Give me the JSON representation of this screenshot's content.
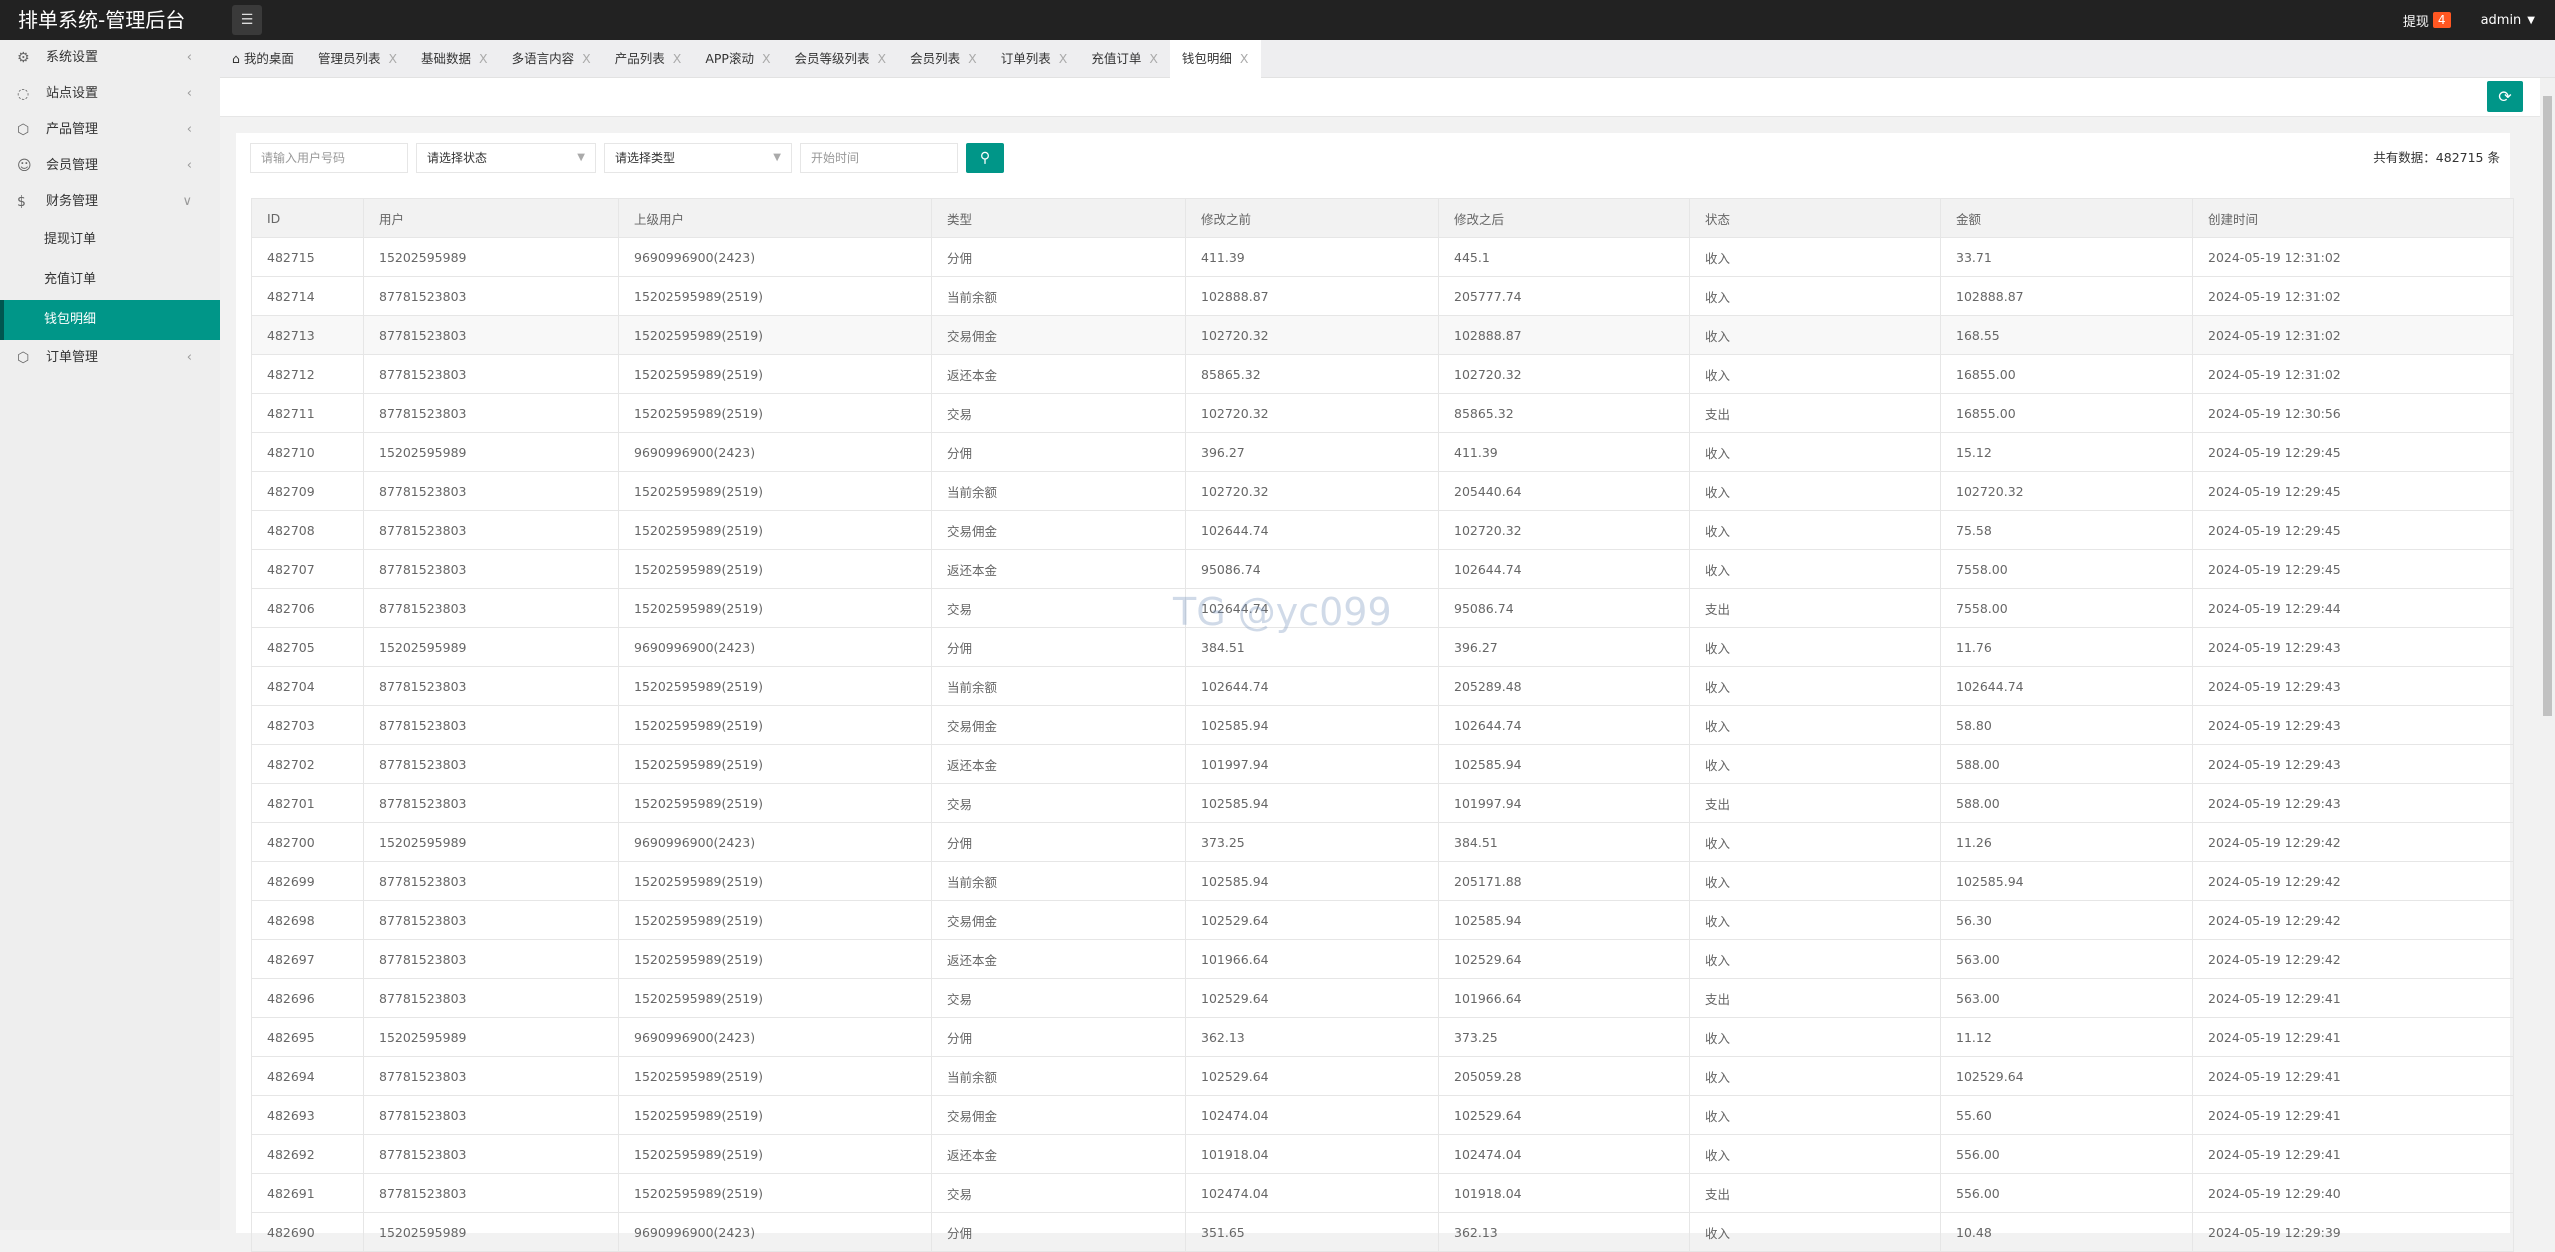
{
  "header": {
    "title": "排单系统-管理后台",
    "withdraw_label": "提现",
    "withdraw_count": "4",
    "user": "admin",
    "menu_icon": "menu-icon"
  },
  "sidebar": {
    "items": [
      {
        "label": "系统设置",
        "icon": "gear-icon"
      },
      {
        "label": "站点设置",
        "icon": "site-icon"
      },
      {
        "label": "产品管理",
        "icon": "box-icon"
      },
      {
        "label": "会员管理",
        "icon": "user-icon"
      },
      {
        "label": "财务管理",
        "icon": "dollar-icon",
        "expanded": true,
        "children": [
          "提现订单",
          "充值订单",
          "钱包明细"
        ],
        "active_child": "钱包明细"
      },
      {
        "label": "订单管理",
        "icon": "box-icon"
      }
    ]
  },
  "tabs": [
    {
      "label": "我的桌面",
      "home": true
    },
    {
      "label": "管理员列表"
    },
    {
      "label": "基础数据"
    },
    {
      "label": "多语言内容"
    },
    {
      "label": "产品列表"
    },
    {
      "label": "APP滚动"
    },
    {
      "label": "会员等级列表"
    },
    {
      "label": "会员列表"
    },
    {
      "label": "订单列表"
    },
    {
      "label": "充值订单"
    },
    {
      "label": "钱包明细",
      "active": true
    }
  ],
  "tab_close": "X",
  "filters": {
    "user_placeholder": "请输入用户号码",
    "status": "请选择状态",
    "type": "请选择类型",
    "time_placeholder": "开始时间"
  },
  "total": "共有数据：482715 条",
  "watermark": "TG @yc099",
  "accent": "#009688",
  "table": {
    "columns": [
      "ID",
      "用户",
      "上级用户",
      "类型",
      "修改之前",
      "修改之后",
      "状态",
      "金额",
      "创建时间"
    ],
    "rows": [
      [
        "482715",
        "15202595989",
        "9690996900(2423)",
        "分佣",
        "411.39",
        "445.1",
        "收入",
        "33.71",
        "2024-05-19 12:31:02"
      ],
      [
        "482714",
        "87781523803",
        "15202595989(2519)",
        "当前余额",
        "102888.87",
        "205777.74",
        "收入",
        "102888.87",
        "2024-05-19 12:31:02"
      ],
      [
        "482713",
        "87781523803",
        "15202595989(2519)",
        "交易佣金",
        "102720.32",
        "102888.87",
        "收入",
        "168.55",
        "2024-05-19 12:31:02"
      ],
      [
        "482712",
        "87781523803",
        "15202595989(2519)",
        "返还本金",
        "85865.32",
        "102720.32",
        "收入",
        "16855.00",
        "2024-05-19 12:31:02"
      ],
      [
        "482711",
        "87781523803",
        "15202595989(2519)",
        "交易",
        "102720.32",
        "85865.32",
        "支出",
        "16855.00",
        "2024-05-19 12:30:56"
      ],
      [
        "482710",
        "15202595989",
        "9690996900(2423)",
        "分佣",
        "396.27",
        "411.39",
        "收入",
        "15.12",
        "2024-05-19 12:29:45"
      ],
      [
        "482709",
        "87781523803",
        "15202595989(2519)",
        "当前余额",
        "102720.32",
        "205440.64",
        "收入",
        "102720.32",
        "2024-05-19 12:29:45"
      ],
      [
        "482708",
        "87781523803",
        "15202595989(2519)",
        "交易佣金",
        "102644.74",
        "102720.32",
        "收入",
        "75.58",
        "2024-05-19 12:29:45"
      ],
      [
        "482707",
        "87781523803",
        "15202595989(2519)",
        "返还本金",
        "95086.74",
        "102644.74",
        "收入",
        "7558.00",
        "2024-05-19 12:29:45"
      ],
      [
        "482706",
        "87781523803",
        "15202595989(2519)",
        "交易",
        "102644.74",
        "95086.74",
        "支出",
        "7558.00",
        "2024-05-19 12:29:44"
      ],
      [
        "482705",
        "15202595989",
        "9690996900(2423)",
        "分佣",
        "384.51",
        "396.27",
        "收入",
        "11.76",
        "2024-05-19 12:29:43"
      ],
      [
        "482704",
        "87781523803",
        "15202595989(2519)",
        "当前余额",
        "102644.74",
        "205289.48",
        "收入",
        "102644.74",
        "2024-05-19 12:29:43"
      ],
      [
        "482703",
        "87781523803",
        "15202595989(2519)",
        "交易佣金",
        "102585.94",
        "102644.74",
        "收入",
        "58.80",
        "2024-05-19 12:29:43"
      ],
      [
        "482702",
        "87781523803",
        "15202595989(2519)",
        "返还本金",
        "101997.94",
        "102585.94",
        "收入",
        "588.00",
        "2024-05-19 12:29:43"
      ],
      [
        "482701",
        "87781523803",
        "15202595989(2519)",
        "交易",
        "102585.94",
        "101997.94",
        "支出",
        "588.00",
        "2024-05-19 12:29:43"
      ],
      [
        "482700",
        "15202595989",
        "9690996900(2423)",
        "分佣",
        "373.25",
        "384.51",
        "收入",
        "11.26",
        "2024-05-19 12:29:42"
      ],
      [
        "482699",
        "87781523803",
        "15202595989(2519)",
        "当前余额",
        "102585.94",
        "205171.88",
        "收入",
        "102585.94",
        "2024-05-19 12:29:42"
      ],
      [
        "482698",
        "87781523803",
        "15202595989(2519)",
        "交易佣金",
        "102529.64",
        "102585.94",
        "收入",
        "56.30",
        "2024-05-19 12:29:42"
      ],
      [
        "482697",
        "87781523803",
        "15202595989(2519)",
        "返还本金",
        "101966.64",
        "102529.64",
        "收入",
        "563.00",
        "2024-05-19 12:29:42"
      ],
      [
        "482696",
        "87781523803",
        "15202595989(2519)",
        "交易",
        "102529.64",
        "101966.64",
        "支出",
        "563.00",
        "2024-05-19 12:29:41"
      ],
      [
        "482695",
        "15202595989",
        "9690996900(2423)",
        "分佣",
        "362.13",
        "373.25",
        "收入",
        "11.12",
        "2024-05-19 12:29:41"
      ],
      [
        "482694",
        "87781523803",
        "15202595989(2519)",
        "当前余额",
        "102529.64",
        "205059.28",
        "收入",
        "102529.64",
        "2024-05-19 12:29:41"
      ],
      [
        "482693",
        "87781523803",
        "15202595989(2519)",
        "交易佣金",
        "102474.04",
        "102529.64",
        "收入",
        "55.60",
        "2024-05-19 12:29:41"
      ],
      [
        "482692",
        "87781523803",
        "15202595989(2519)",
        "返还本金",
        "101918.04",
        "102474.04",
        "收入",
        "556.00",
        "2024-05-19 12:29:41"
      ],
      [
        "482691",
        "87781523803",
        "15202595989(2519)",
        "交易",
        "102474.04",
        "101918.04",
        "支出",
        "556.00",
        "2024-05-19 12:29:40"
      ],
      [
        "482690",
        "15202595989",
        "9690996900(2423)",
        "分佣",
        "351.65",
        "362.13",
        "收入",
        "10.48",
        "2024-05-19 12:29:39"
      ]
    ]
  }
}
